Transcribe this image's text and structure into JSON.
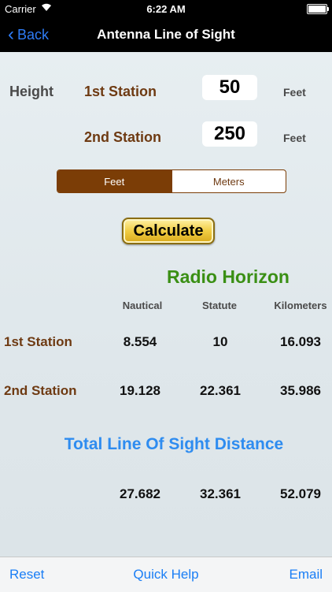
{
  "status_bar": {
    "carrier": "Carrier",
    "time": "6:22 AM"
  },
  "nav": {
    "back_label": "Back",
    "title": "Antenna Line of Sight"
  },
  "height": {
    "label": "Height",
    "station1_label": "1st Station",
    "station2_label": "2nd Station",
    "station1_value": "50",
    "station2_value": "250",
    "unit1": "Feet",
    "unit2": "Feet"
  },
  "units_toggle": {
    "options": [
      "Feet",
      "Meters"
    ],
    "selected": "Feet"
  },
  "calculate_label": "Calculate",
  "radio_horizon": {
    "title": "Radio Horizon",
    "columns": [
      "Nautical",
      "Statute",
      "Kilometers"
    ],
    "rows": [
      {
        "label": "1st Station",
        "values": [
          "8.554",
          "10",
          "16.093"
        ]
      },
      {
        "label": "2nd Station",
        "values": [
          "19.128",
          "22.361",
          "35.986"
        ]
      }
    ]
  },
  "total": {
    "title": "Total Line Of Sight Distance",
    "values": [
      "27.682",
      "32.361",
      "52.079"
    ]
  },
  "toolbar": {
    "reset": "Reset",
    "quick_help": "Quick Help",
    "email": "Email"
  },
  "colors": {
    "station_brown": "#6e3a12",
    "radio_green": "#3a8f14",
    "total_blue": "#2e8cf0",
    "ios_blue": "#1a7ef5"
  }
}
